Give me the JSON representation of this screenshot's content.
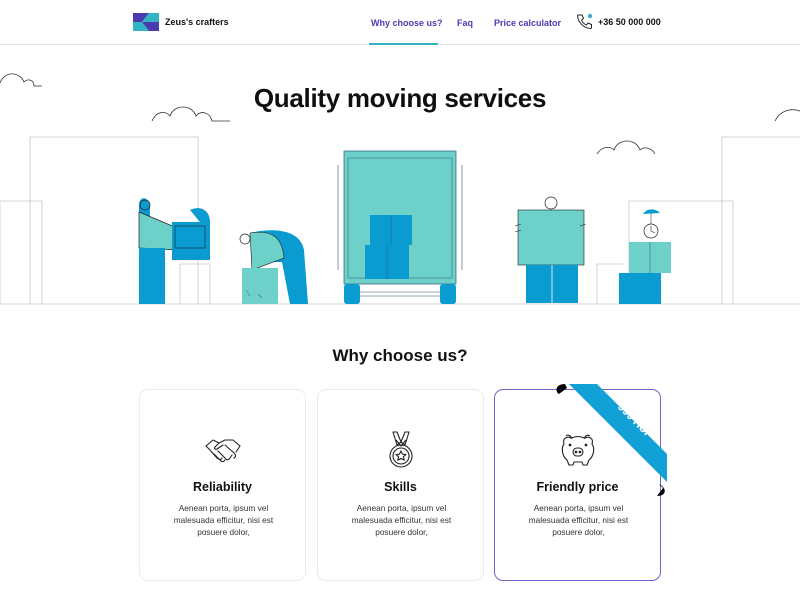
{
  "header": {
    "brand": "Zeus's crafters",
    "nav": [
      {
        "label": "Why choose us?",
        "active": true
      },
      {
        "label": "Faq",
        "active": false
      },
      {
        "label": "Price calculator",
        "active": false
      }
    ],
    "phone": "+36 50 000 000"
  },
  "hero": {
    "title": "Quality moving services"
  },
  "section": {
    "title": "Why choose us?",
    "cards": [
      {
        "icon": "handshake-icon",
        "title": "Reliability",
        "text": "Aenean porta, ipsum vel malesuada efficitur, nisi est posuere dolor,"
      },
      {
        "icon": "medal-icon",
        "title": "Skills",
        "text": "Aenean porta, ipsum vel malesuada efficitur, nisi est posuere dolor,"
      },
      {
        "icon": "piggy-bank-icon",
        "title": "Friendly price",
        "text": "Aenean porta, ipsum vel malesuada efficitur, nisi est posuere dolor,",
        "ribbon": "999 HUF",
        "highlighted": true
      }
    ]
  },
  "colors": {
    "brand": "#4b3bb0",
    "accent": "#34b3c4",
    "teal": "#6dd0c9",
    "blue": "#0a9bd1",
    "ribbon": "#12a1d6"
  }
}
